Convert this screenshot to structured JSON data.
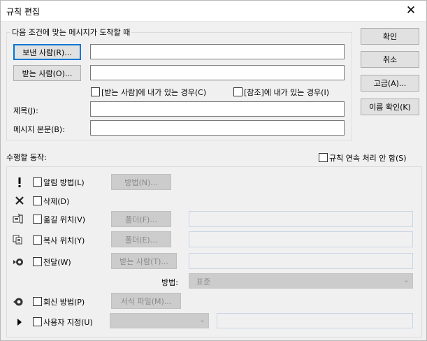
{
  "window": {
    "title": "규칙 편집",
    "close_glyph": "✕"
  },
  "conditions": {
    "group_label": "다음 조건에 맞는 메시지가 도착할 때",
    "from_button": "보낸 사람(R)...",
    "from_value": "",
    "to_button": "받는 사람(O)...",
    "to_value": "",
    "to_me_checkbox": "[받는 사람]에 내가 있는 경우(C)",
    "cc_me_checkbox": "[참조]에 내가 있는 경우(I)",
    "subject_label": "제목(J):",
    "subject_value": "",
    "body_label": "메시지 본문(B):",
    "body_value": ""
  },
  "side_buttons": {
    "ok": "확인",
    "cancel": "취소",
    "advanced": "고급(A)...",
    "check_names": "이름 확인(K)"
  },
  "actions": {
    "label": "수행할 동작:",
    "stop_rules": "규칙 연속 처리 안 함(S)",
    "alert_label": "알림 방법(L)",
    "alert_button": "방법(N)...",
    "delete_label": "삭제(D)",
    "move_label": "옮길 위치(V)",
    "move_button": "폴더(F)...",
    "copy_label": "복사 위치(Y)",
    "copy_button": "폴더(E)...",
    "forward_label": "전달(W)",
    "forward_button": "받는 사람(T)...",
    "method_label": "방법:",
    "method_value": "표준",
    "reply_label": "회신 방법(P)",
    "reply_button": "서식 파일(M)...",
    "custom_label": "사용자 지정(U)"
  },
  "icons": {
    "alert": "exclamation-icon",
    "delete": "delete-x-icon",
    "move": "move-to-folder-icon",
    "copy": "copy-to-folder-icon",
    "forward": "forward-icon",
    "reply": "reply-icon",
    "custom": "play-arrow-icon"
  },
  "colors": {
    "accent": "#0078d7",
    "disabled_field_border": "#cad5e6"
  }
}
